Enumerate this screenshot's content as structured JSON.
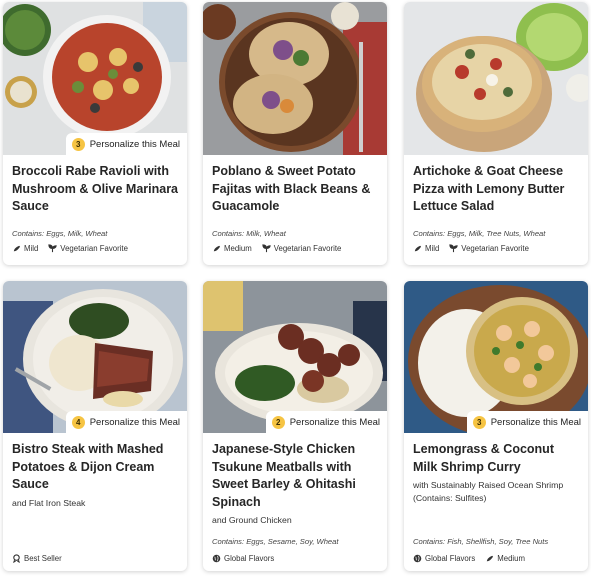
{
  "meals": [
    {
      "title": "Broccoli Rabe Ravioli with Mushroom & Olive Marinara Sauce",
      "subtitle": "",
      "contains": "Contains: Eggs, Milk, Wheat",
      "tags": [
        {
          "icon": "pepper-icon",
          "label": "Mild"
        },
        {
          "icon": "sprout-icon",
          "label": "Vegetarian Favorite"
        }
      ],
      "personalize": null
    },
    {
      "title": "Poblano & Sweet Potato Fajitas with Black Beans & Guacamole",
      "subtitle": "",
      "contains": "Contains: Milk, Wheat",
      "tags": [
        {
          "icon": "pepper-icon",
          "label": "Medium"
        },
        {
          "icon": "sprout-icon",
          "label": "Vegetarian Favorite"
        }
      ],
      "personalize": null
    },
    {
      "title": "Artichoke & Goat Cheese Pizza with Lemony Butter Lettuce Salad",
      "subtitle": "",
      "contains": "Contains: Eggs, Milk, Tree Nuts, Wheat",
      "tags": [
        {
          "icon": "pepper-icon",
          "label": "Mild"
        },
        {
          "icon": "sprout-icon",
          "label": "Vegetarian Favorite"
        }
      ],
      "personalize": null
    },
    {
      "title": "Bistro Steak with Mashed Potatoes & Dijon Cream Sauce",
      "subtitle": "and Flat Iron Steak",
      "contains": "",
      "tags": [
        {
          "icon": "ribbon-icon",
          "label": "Best Seller"
        }
      ],
      "personalize": null
    },
    {
      "title": "Japanese-Style Chicken Tsukune Meatballs with Sweet Barley & Ohitashi Spinach",
      "subtitle": "and Ground Chicken",
      "contains": "Contains: Eggs, Sesame, Soy, Wheat",
      "tags": [
        {
          "icon": "globe-icon",
          "label": "Global Flavors"
        }
      ],
      "personalize": null
    },
    {
      "title": "Lemongrass & Coconut Milk Shrimp Curry",
      "subtitle": "with Sustainably Raised Ocean Shrimp (Contains: Sulfites)",
      "contains": "Contains: Fish, Shellfish, Soy, Tree Nuts",
      "tags": [
        {
          "icon": "globe-icon",
          "label": "Global Flavors"
        },
        {
          "icon": "pepper-icon",
          "label": "Medium"
        }
      ],
      "personalize": null
    }
  ],
  "personalize": [
    {
      "count": "3",
      "label": "Personalize this Meal"
    },
    {
      "count": "4",
      "label": "Personalize this Meal"
    },
    {
      "count": "2",
      "label": "Personalize this Meal"
    },
    {
      "count": "3",
      "label": "Personalize this Meal"
    }
  ]
}
